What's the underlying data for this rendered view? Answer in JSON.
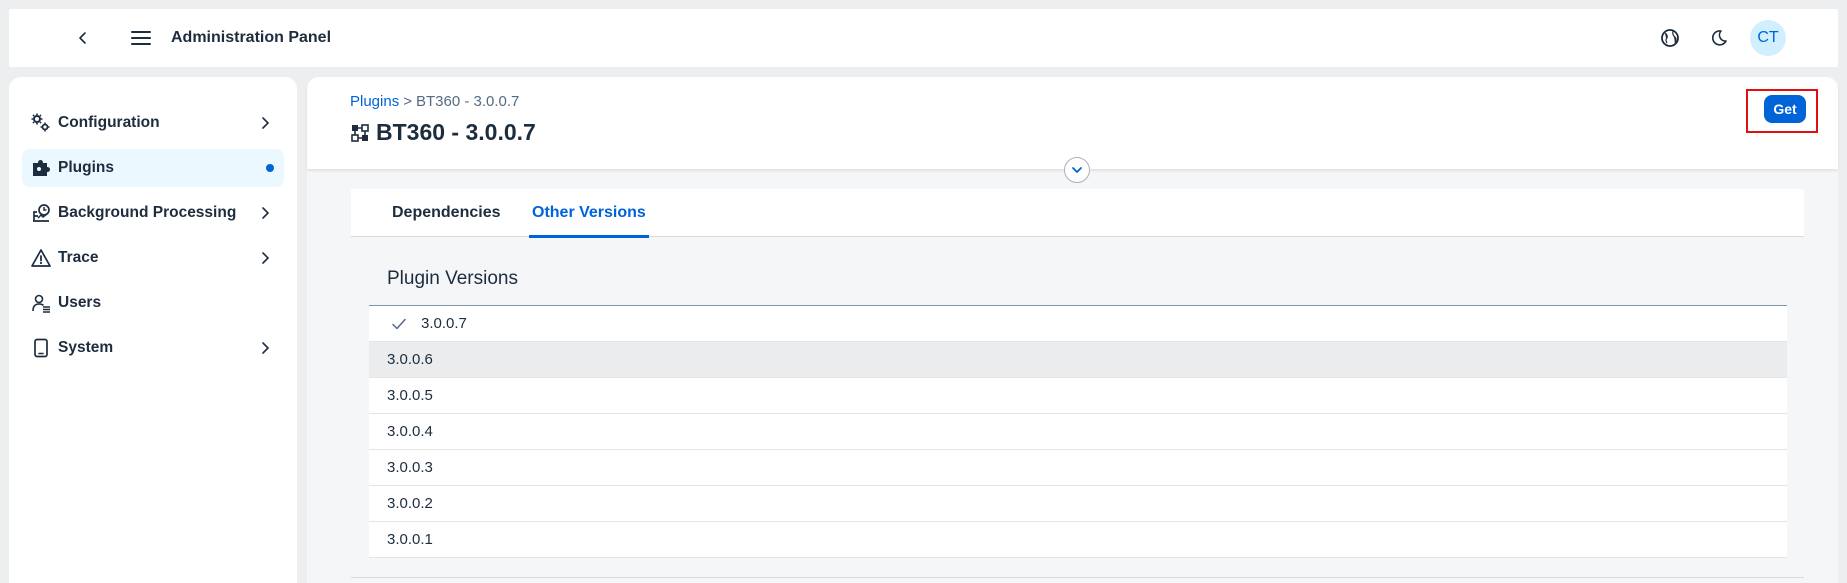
{
  "header": {
    "title": "Administration Panel",
    "avatar_initials": "CT",
    "icons": [
      "back-icon",
      "menu-icon",
      "globe-icon",
      "moon-icon"
    ]
  },
  "sidebar": {
    "items": [
      {
        "label": "Configuration",
        "icon": "gears-icon",
        "has_arrow": true
      },
      {
        "label": "Plugins",
        "icon": "puzzle-icon",
        "selected": true
      },
      {
        "label": "Background Processing",
        "icon": "background-processing-icon",
        "has_arrow": true
      },
      {
        "label": "Trace",
        "icon": "warning-triangle-icon",
        "has_arrow": true
      },
      {
        "label": "Users",
        "icon": "user-list-icon",
        "has_arrow": false
      },
      {
        "label": "System",
        "icon": "tablet-icon",
        "has_arrow": true
      }
    ]
  },
  "object_header": {
    "breadcrumb_link": "Plugins",
    "breadcrumb_separator": ">",
    "breadcrumb_current": "BT360 - 3.0.0.7",
    "title": "BT360 - 3.0.0.7",
    "get_button": "Get"
  },
  "tabs": [
    {
      "label": "Dependencies",
      "active": false
    },
    {
      "label": "Other Versions",
      "active": true
    }
  ],
  "versions": {
    "title": "Plugin Versions",
    "current": "3.0.0.7",
    "items": [
      "3.0.0.7",
      "3.0.0.6",
      "3.0.0.5",
      "3.0.0.4",
      "3.0.0.3",
      "3.0.0.2",
      "3.0.0.1"
    ]
  },
  "colors": {
    "accent": "#0064d9",
    "highlight": "#e01010"
  }
}
